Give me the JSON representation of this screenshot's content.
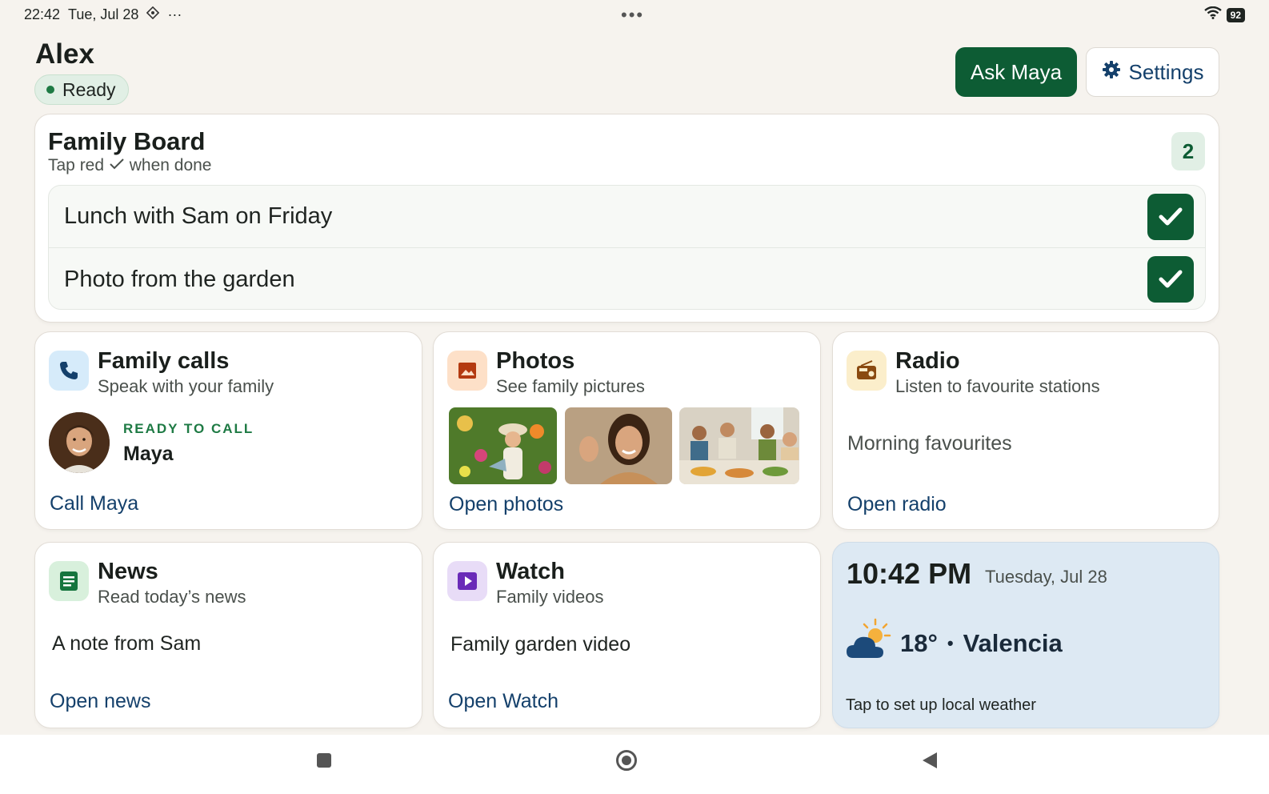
{
  "status": {
    "time": "22:42",
    "date": "Tue, Jul 28",
    "extra": "···",
    "center_dots": "•••",
    "battery": "92"
  },
  "header": {
    "user_name": "Alex",
    "status_badge": "Ready",
    "ask_button": "Ask Maya",
    "settings_button": "Settings"
  },
  "family_board": {
    "title": "Family Board",
    "subtitle_before": "Tap red",
    "subtitle_after": "when done",
    "count": "2",
    "items": [
      {
        "label": "Lunch with Sam on Friday"
      },
      {
        "label": "Photo from the garden"
      }
    ]
  },
  "tiles": {
    "calls": {
      "title": "Family calls",
      "subtitle": "Speak with your family",
      "status": "READY TO CALL",
      "contact": "Maya",
      "action": "Call Maya"
    },
    "photos": {
      "title": "Photos",
      "subtitle": "See family pictures",
      "action": "Open photos"
    },
    "radio": {
      "title": "Radio",
      "subtitle": "Listen to favourite stations",
      "item": "Morning favourites",
      "action": "Open radio"
    },
    "news": {
      "title": "News",
      "subtitle": "Read today’s news",
      "item": "A note from Sam",
      "action": "Open news"
    },
    "watch": {
      "title": "Watch",
      "subtitle": "Family videos",
      "item": "Family garden video",
      "action": "Open Watch"
    },
    "clock": {
      "time": "10:42 PM",
      "date": "Tuesday, Jul 28",
      "temperature": "18°",
      "separator": "•",
      "city": "Valencia",
      "hint": "Tap to set up local weather"
    }
  },
  "colors": {
    "primary_green": "#0d5c34",
    "link_blue": "#14406b",
    "background": "#f6f3ee",
    "weather_card": "#dde9f3"
  }
}
